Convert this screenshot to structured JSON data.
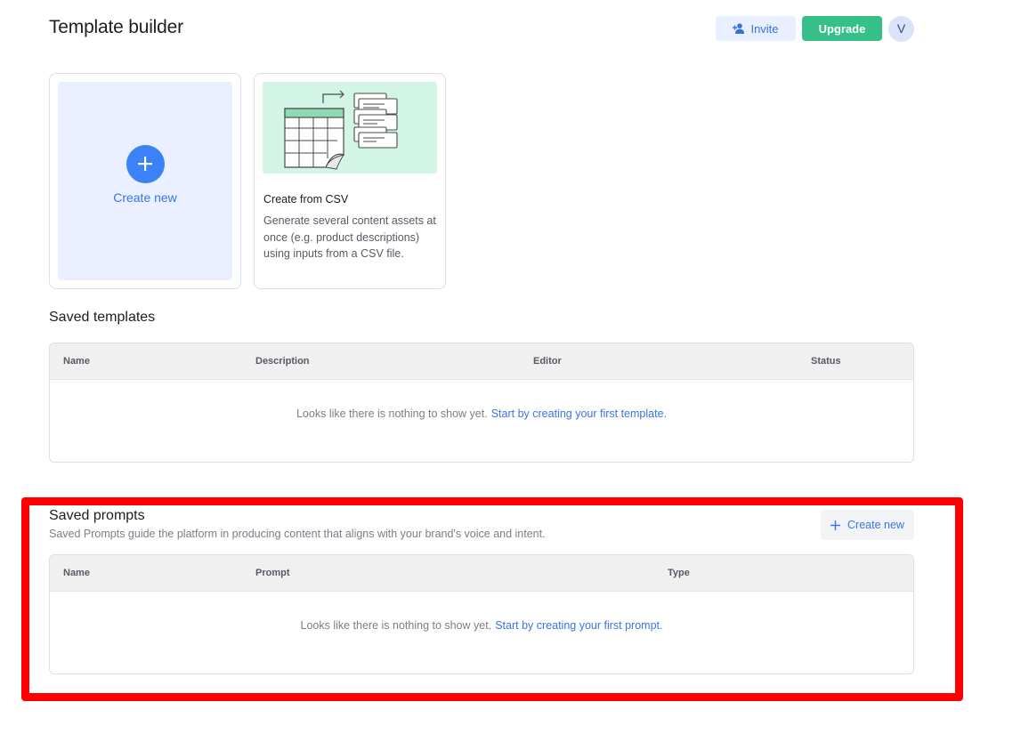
{
  "header": {
    "title": "Template builder",
    "invite_label": "Invite",
    "upgrade_label": "Upgrade",
    "avatar_initial": "V"
  },
  "cards": {
    "create_new": {
      "label": "Create new"
    },
    "csv": {
      "title": "Create from CSV",
      "description": "Generate several content assets at once (e.g. product descriptions) using inputs from a CSV file."
    }
  },
  "saved_templates": {
    "title": "Saved templates",
    "columns": [
      "Name",
      "Description",
      "Editor",
      "Status"
    ],
    "empty_text": "Looks like there is nothing to show yet.",
    "empty_link": "Start by creating your first template."
  },
  "saved_prompts": {
    "title": "Saved prompts",
    "subtitle": "Saved Prompts guide the platform in producing content that aligns with your brand's voice and intent.",
    "create_new_label": "Create new",
    "columns": [
      "Name",
      "Prompt",
      "Type"
    ],
    "empty_text": "Looks like there is nothing to show yet.",
    "empty_link": "Start by creating your first prompt."
  },
  "colors": {
    "accent_blue": "#3b82f6",
    "upgrade_green": "#35c08a",
    "highlight_red": "#ff0000",
    "csv_illustration_bg": "#d2f5e6",
    "create_card_bg": "#eaf0ff"
  },
  "icons": {
    "invite": "add-user-icon",
    "create_new_card": "plus-icon",
    "create_new_prompt": "plus-icon"
  }
}
